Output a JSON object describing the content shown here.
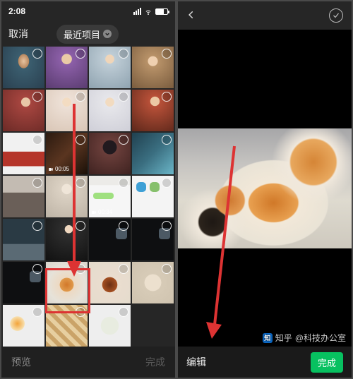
{
  "status": {
    "time": "2:08",
    "recording_dot": true
  },
  "left": {
    "cancel": "取消",
    "title": "最近项目",
    "preview": "预览",
    "done": "完成",
    "video_durations": {
      "r3c2": "00:05",
      "r4c3": "00:34"
    }
  },
  "right": {
    "edit": "编辑",
    "done": "完成"
  },
  "watermark": {
    "brand": "知乎",
    "author": "@科技办公室",
    "logo_text": "知"
  },
  "colors": {
    "accent_green": "#07c160",
    "highlight_red": "#d33"
  }
}
